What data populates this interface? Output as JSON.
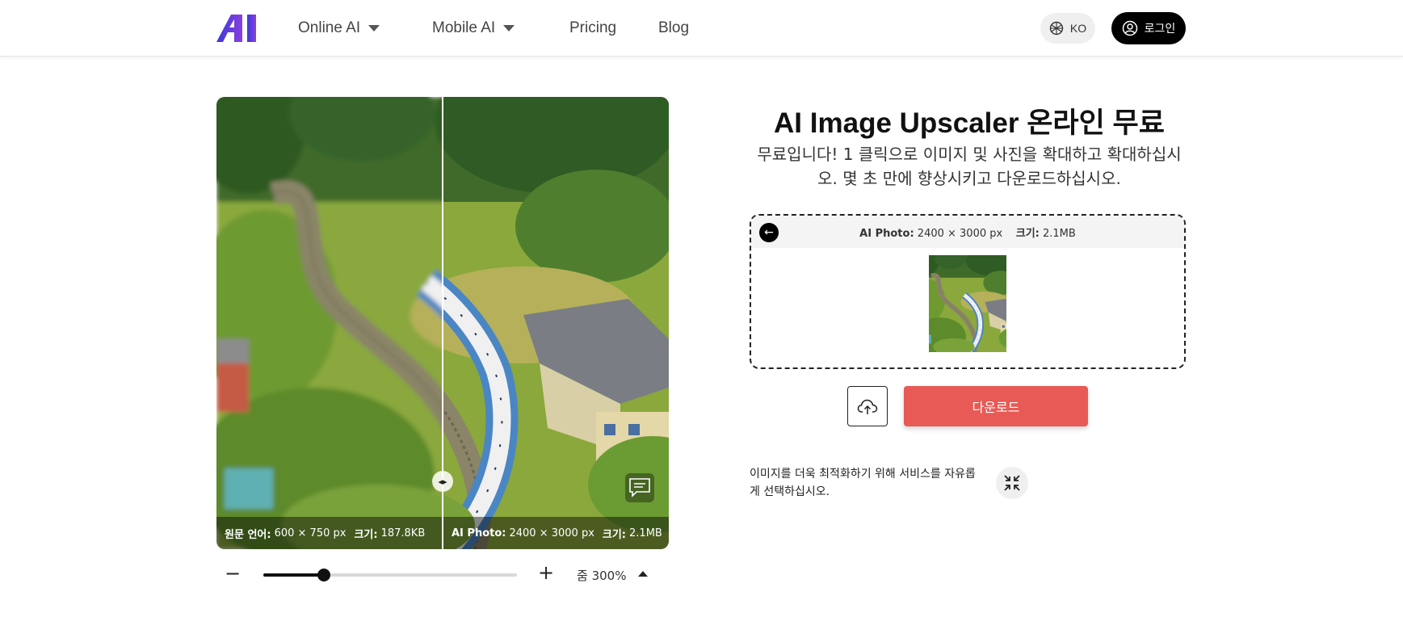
{
  "header": {
    "logo_text": "AI",
    "nav": [
      {
        "label": "Online AI",
        "has_dropdown": true
      },
      {
        "label": "Mobile AI",
        "has_dropdown": true
      },
      {
        "label": "Pricing",
        "has_dropdown": false
      },
      {
        "label": "Blog",
        "has_dropdown": false
      }
    ],
    "lang_label": "KO",
    "login_label": "로그인"
  },
  "compare": {
    "original_caption": {
      "label": "원문 언어:",
      "dims": "600 × 750 px",
      "size_label": "크기:",
      "size": "187.8KB"
    },
    "ai_caption": {
      "label": "AI Photo:",
      "dims": "2400 × 3000 px",
      "size_label": "크기:",
      "size": "2.1MB"
    }
  },
  "zoom": {
    "label": "줌 300%",
    "level_fraction": 0.24
  },
  "hero": {
    "title": "AI Image Upscaler 온라인 무료",
    "subtitle": "무료입니다! 1 클릭으로 이미지 및 사진을 확대하고 확대하십시오. 몇 초 만에 향상시키고 다운로드하십시오."
  },
  "result": {
    "label": "AI Photo:",
    "dims": "2400 × 3000 px",
    "size_label": "크기:",
    "size": "2.1MB"
  },
  "actions": {
    "download_label": "다운로드"
  },
  "optimize_text": "이미지를 더욱 최적화하기 위해 서비스를 자유롭게 선택하십시오.",
  "colors": {
    "download": "#e85a55",
    "logo_gradient_start": "#3a3ad6",
    "logo_gradient_end": "#8a3ee0"
  }
}
